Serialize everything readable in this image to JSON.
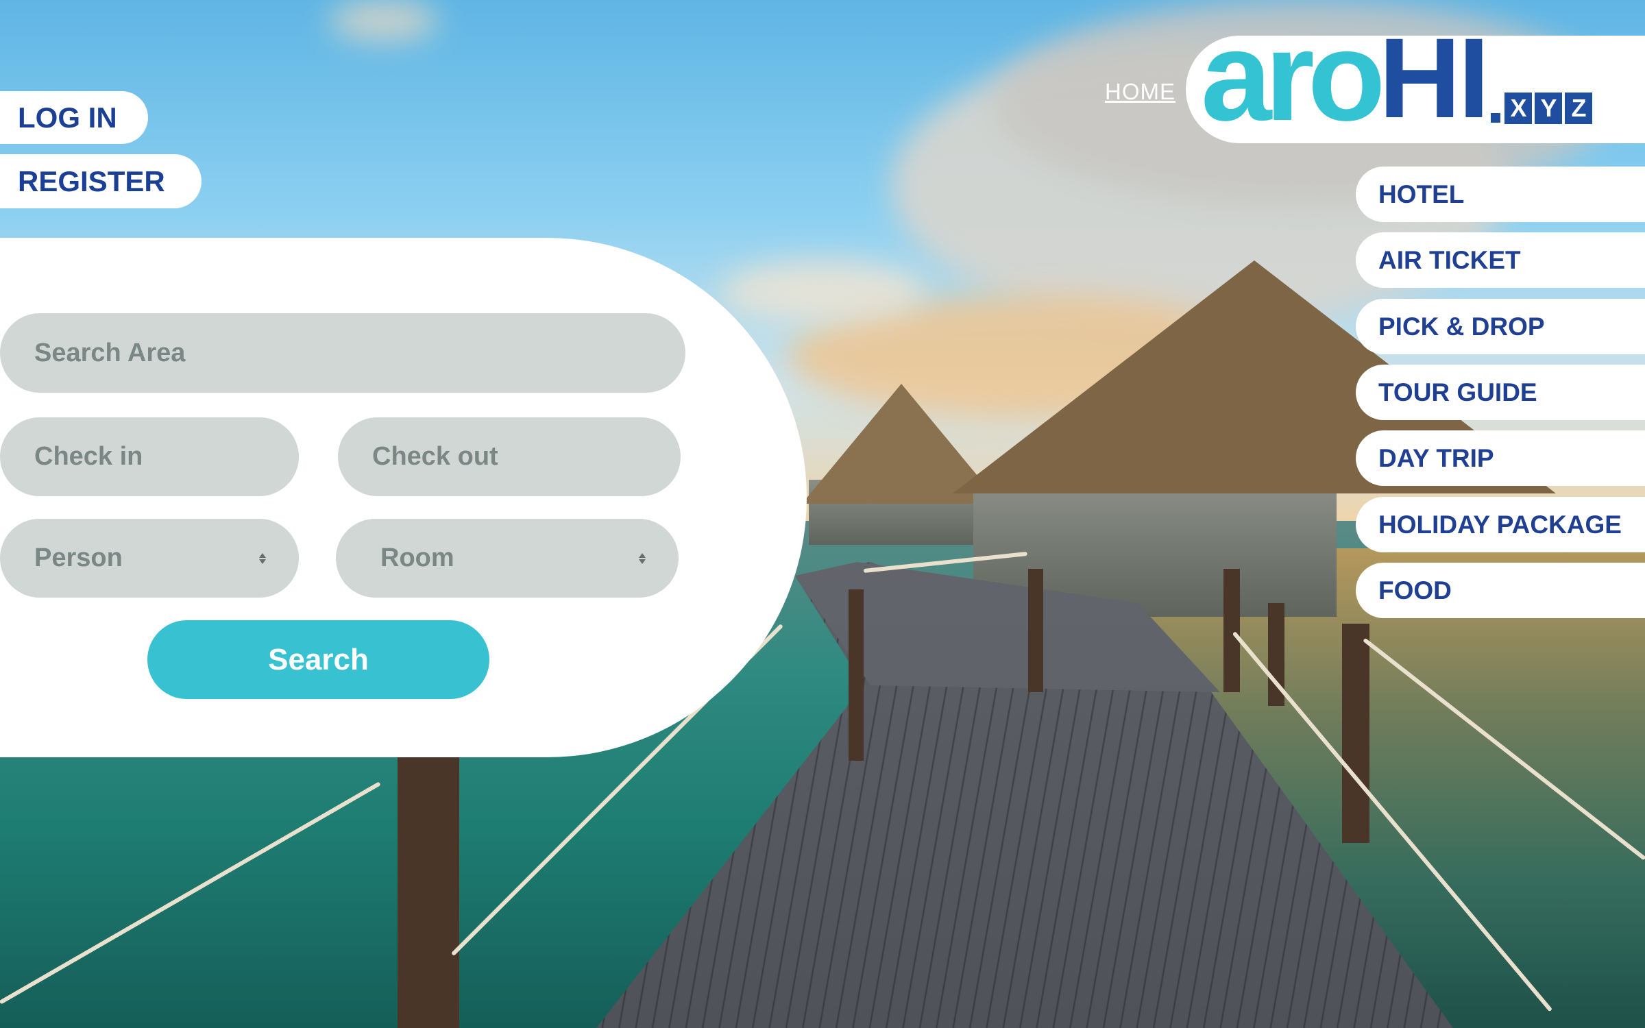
{
  "auth": {
    "login_label": "LOG IN",
    "register_label": "REGISTER"
  },
  "header": {
    "home_label": "HOME",
    "logo": {
      "part1": "aro",
      "part2": "HI",
      "dot": ".",
      "tld": [
        "X",
        "Y",
        "Z"
      ]
    }
  },
  "nav": {
    "items": [
      {
        "label": "HOTEL"
      },
      {
        "label": "AIR TICKET"
      },
      {
        "label": "PICK & DROP"
      },
      {
        "label": "TOUR GUIDE"
      },
      {
        "label": "DAY TRIP"
      },
      {
        "label": "HOLIDAY PACKAGE"
      },
      {
        "label": "FOOD"
      }
    ]
  },
  "search": {
    "area_placeholder": "Search Area",
    "checkin_placeholder": "Check in",
    "checkout_placeholder": "Check out",
    "person_placeholder": "Person",
    "room_placeholder": "Room",
    "button_label": "Search"
  },
  "colors": {
    "brand_blue": "#1f4da0",
    "brand_cyan": "#33c3d2",
    "button_cyan": "#37c1d1",
    "field_gray": "#d1d7d4",
    "placeholder_gray": "#7a8784"
  },
  "background": {
    "description_icon": "overwater-bungalow-photo"
  }
}
